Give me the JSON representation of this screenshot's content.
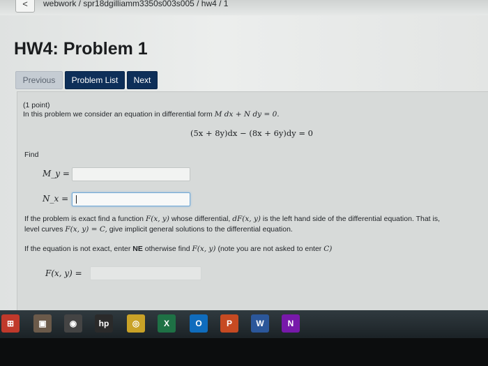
{
  "breadcrumb": {
    "back_glyph": "<",
    "path": "webwork / spr18dgilliamm3350s003s005 / hw4 / 1"
  },
  "page": {
    "title": "HW4: Problem 1"
  },
  "nav": {
    "previous": "Previous",
    "problem_list": "Problem List",
    "next": "Next"
  },
  "problem": {
    "points": "(1 point)",
    "intro": "In this problem we consider an equation in differential form",
    "intro_math": "M dx + N dy = 0.",
    "equation": "(5x + 8y)dx − (8x + 6y)dy = 0",
    "find": "Find",
    "my_label": "M_y =",
    "nx_label": "N_x =",
    "my_value": "",
    "nx_value": "",
    "exact_line1_a": "If the problem is exact find a function",
    "exact_line1_m1": "F(x, y)",
    "exact_line1_b": "whose differential,",
    "exact_line1_m2": "dF(x, y)",
    "exact_line1_c": "is the left hand side of the differential equation. That is,",
    "exact_line2_a": "level curves",
    "exact_line2_m": "F(x, y) = C,",
    "exact_line2_b": "give implicit general solutions to the differential equation.",
    "ne_a": "If the equation is not exact, enter",
    "ne_bold": "NE",
    "ne_b": "otherwise find",
    "ne_m1": "F(x, y)",
    "ne_c": "(note you are not asked to enter",
    "ne_m2": "C)",
    "f_label": "F(x, y) =",
    "f_value": ""
  },
  "taskbar": {
    "apps": [
      {
        "icon": "start-icon",
        "glyph": "⊞",
        "color": "#c0392b"
      },
      {
        "icon": "photos-icon",
        "glyph": "▣",
        "color": "#6b5a4a"
      },
      {
        "icon": "media-player-icon",
        "glyph": "◉",
        "color": "#444"
      },
      {
        "icon": "hp-icon",
        "glyph": "hp",
        "color": "#2a2a2a"
      },
      {
        "icon": "chrome-icon",
        "glyph": "◎",
        "color": "#c9a227"
      },
      {
        "icon": "excel-icon",
        "glyph": "X",
        "color": "#1e7145"
      },
      {
        "icon": "outlook-icon",
        "glyph": "O",
        "color": "#0f6cbd"
      },
      {
        "icon": "powerpoint-icon",
        "glyph": "P",
        "color": "#c64a22"
      },
      {
        "icon": "word-icon",
        "glyph": "W",
        "color": "#2b579a"
      },
      {
        "icon": "onenote-icon",
        "glyph": "N",
        "color": "#7719aa"
      }
    ]
  }
}
